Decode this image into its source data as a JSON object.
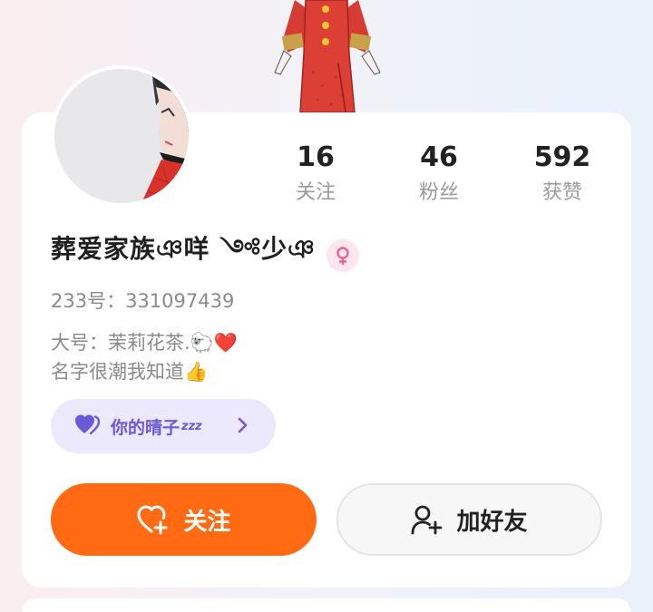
{
  "stats": [
    {
      "value": "16",
      "label": "关注"
    },
    {
      "value": "46",
      "label": "粉丝"
    },
    {
      "value": "592",
      "label": "获赞"
    }
  ],
  "profile": {
    "name": "葬爱家族ঞ咩 ༺少ঞ",
    "gender_icon": "female-icon",
    "uid": "233号：331097439",
    "bio_lines": [
      "大号：茉莉花茶.🐑❤️",
      "名字很潮我知道👍"
    ]
  },
  "tag": {
    "icon": "heart-icon",
    "label": "你的晴子",
    "suffix": "zzz"
  },
  "buttons": {
    "follow_label": "关注",
    "add_friend_label": "加好友"
  },
  "colors": {
    "accent": "#ff6a13",
    "tag_text": "#6a5ad8",
    "tag_bg": "#ebe9fb",
    "female_badge": "#f06292"
  }
}
